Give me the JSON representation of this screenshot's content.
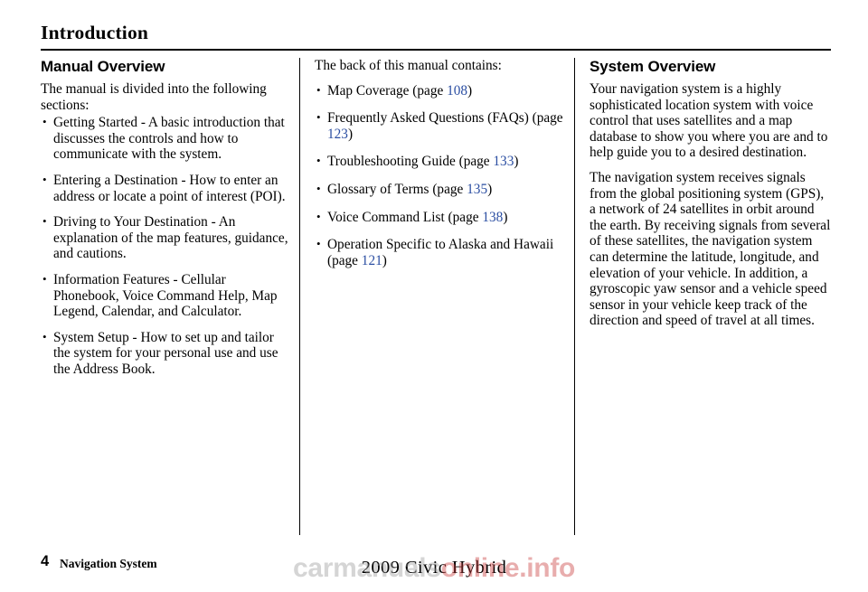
{
  "header": {
    "title": "Introduction"
  },
  "columns": {
    "left": {
      "heading": "Manual Overview",
      "intro": "The manual is divided into the following sections:",
      "bullets": [
        "Getting Started - A basic introduction that discusses the controls and how to communicate with the system.",
        "Entering a Destination - How to enter an address or locate a point of interest (POI).",
        "Driving to Your Destination - An explanation of the map features, guidance, and cautions.",
        "Information Features - Cellular Phonebook, Voice Command Help, Map Legend, Calendar, and Calculator.",
        "System Setup - How to set up and tailor the system for your personal use and use the Address Book."
      ]
    },
    "middle": {
      "intro": "The back of this manual contains:",
      "bullets": [
        {
          "pre": "Map Coverage (page ",
          "page": "108",
          "post": ")"
        },
        {
          "pre": "Frequently Asked Questions (FAQs) (page ",
          "page": "123",
          "post": ")"
        },
        {
          "pre": "Troubleshooting Guide (page ",
          "page": "133",
          "post": ")"
        },
        {
          "pre": "Glossary of Terms (page ",
          "page": "135",
          "post": ")"
        },
        {
          "pre": "Voice Command List (page ",
          "page": "138",
          "post": ")"
        },
        {
          "pre": "Operation Specific to Alaska and Hawaii (page ",
          "page": "121",
          "post": ")"
        }
      ]
    },
    "right": {
      "heading": "System Overview",
      "paragraph1": "Your navigation system is a highly sophisticated location system with voice control that uses satellites and a map database to show you where you are and to help guide you to a desired destination.",
      "paragraph2": "The navigation system receives signals from the global positioning system (GPS), a network of 24 satellites in orbit around the earth. By receiving signals from several of these satellites, the navigation system can determine the latitude, longitude, and elevation of your vehicle. In addition, a gyroscopic yaw sensor and a vehicle speed sensor in your vehicle keep track of the direction and speed of travel at all times."
    }
  },
  "footer": {
    "page_number": "4",
    "section_label": "Navigation System",
    "model": "2009  Civic  Hybrid",
    "watermark_left": "carmanuals",
    "watermark_right": "online.info"
  },
  "colors": {
    "page_link": "#2b4ea2",
    "text": "#000000",
    "background": "#ffffff"
  }
}
